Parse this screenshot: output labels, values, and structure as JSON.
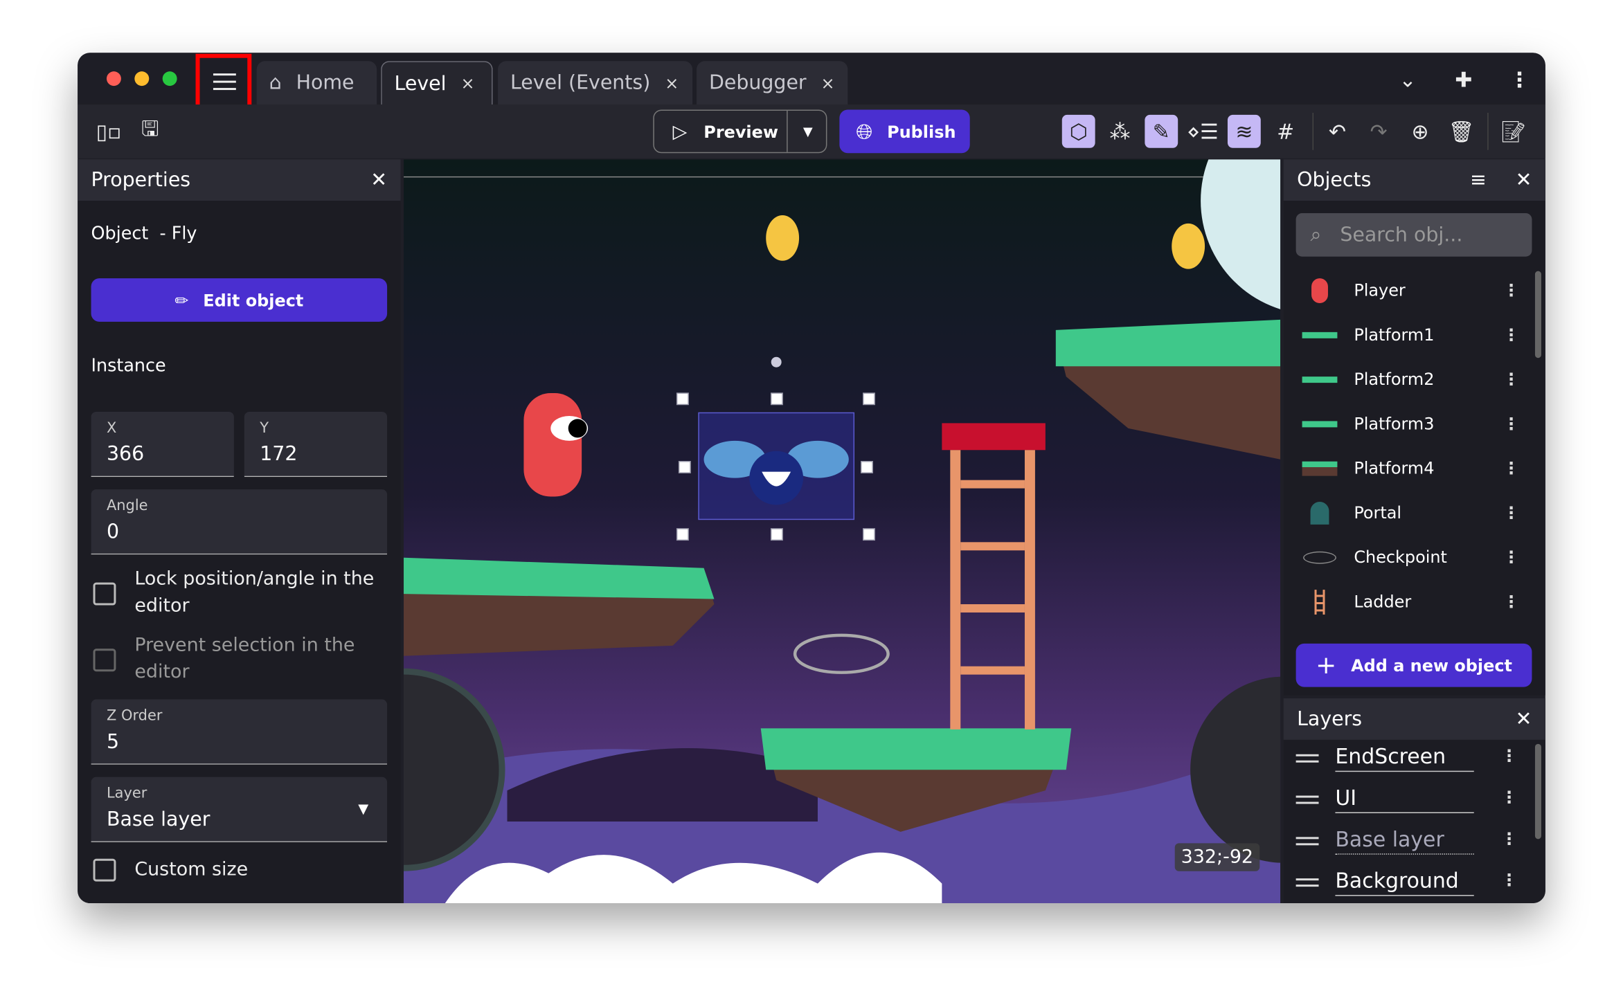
{
  "window": {
    "traffic_lights": [
      "#ff5f57",
      "#febc2e",
      "#28c840"
    ]
  },
  "tabs": [
    {
      "label": "Home",
      "icon": "home-icon"
    },
    {
      "label": "Level",
      "active": true,
      "close": "×"
    },
    {
      "label": "Level (Events)",
      "close": "×"
    },
    {
      "label": "Debugger",
      "close": "×"
    }
  ],
  "toolbar": {
    "preview_label": "Preview",
    "publish_label": "Publish",
    "accent": "#4a2fd0"
  },
  "properties": {
    "title": "Properties",
    "object_label": "Object  - Fly",
    "edit_button": "Edit object",
    "instance_heading": "Instance",
    "x_label": "X",
    "x_value": "366",
    "y_label": "Y",
    "y_value": "172",
    "angle_label": "Angle",
    "angle_value": "0",
    "lock_label": "Lock position/angle in the editor",
    "lock_checked": false,
    "prevent_label": "Prevent selection in the editor",
    "prevent_checked": false,
    "z_label": "Z Order",
    "z_value": "5",
    "layer_label": "Layer",
    "layer_value": "Base layer",
    "custom_size_label": "Custom size",
    "custom_size_checked": false
  },
  "canvas": {
    "cursor_coords": "332;-92"
  },
  "objects": {
    "title": "Objects",
    "search_placeholder": "Search obj...",
    "items": [
      {
        "name": "Player"
      },
      {
        "name": "Platform1"
      },
      {
        "name": "Platform2"
      },
      {
        "name": "Platform3"
      },
      {
        "name": "Platform4"
      },
      {
        "name": "Portal"
      },
      {
        "name": "Checkpoint"
      },
      {
        "name": "Ladder"
      }
    ],
    "add_button": "Add a new object"
  },
  "layers": {
    "title": "Layers",
    "items": [
      {
        "name": "EndScreen"
      },
      {
        "name": "UI"
      },
      {
        "name": "Base layer",
        "current": true
      },
      {
        "name": "Background"
      }
    ]
  }
}
